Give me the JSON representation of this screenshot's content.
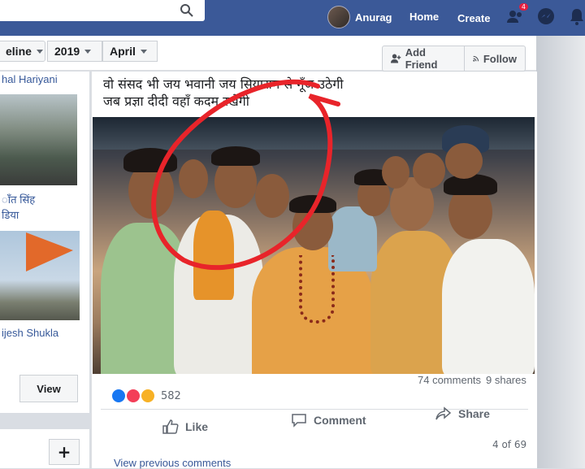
{
  "header": {
    "profile_name": "Anurag",
    "home_label": "Home",
    "create_label": "Create",
    "friend_requests_count": "4"
  },
  "filters": {
    "timeline_label": "eline",
    "year": "2019",
    "month": "April"
  },
  "cover_actions": {
    "add_friend": "Add Friend",
    "follow": "Follow"
  },
  "sidebar": {
    "friend_1_name": "hal Hariyani",
    "friend_2_name_line1": "ाँत सिंह",
    "friend_2_name_line2": "डिया",
    "friend_3_name": "ijesh Shukla",
    "view_button": "View",
    "add_button": "+"
  },
  "post": {
    "text_line1": "वो संसद भी जय भवानी जय सियाराम से गूँज उठेगी",
    "text_line2": "जब प्रज्ञा दीदी वहाँ कदम रखेगी",
    "reactions_count": "582",
    "comments_count": "74 comments",
    "shares_count": "9 shares",
    "like_label": "Like",
    "comment_label": "Comment",
    "share_label": "Share",
    "pager": "4 of 69",
    "view_previous": "View previous comments"
  },
  "colors": {
    "brand_blue": "#3b5998",
    "highlight_circle": "#e8242a"
  }
}
